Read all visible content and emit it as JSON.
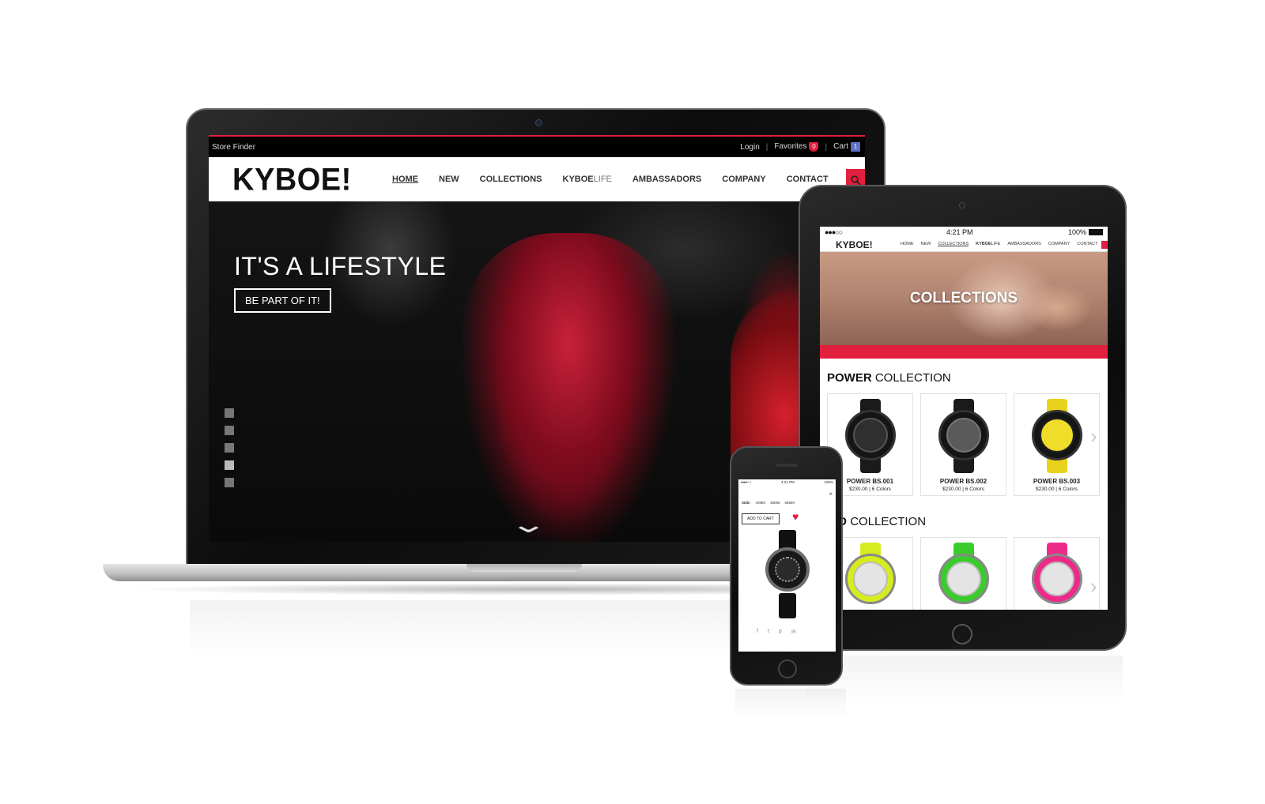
{
  "desktop": {
    "utility": {
      "store_finder": "Store Finder",
      "login": "Login",
      "favorites": "Favorites",
      "favorites_count": "0",
      "cart": "Cart",
      "cart_count": "1"
    },
    "logo": "KYBOE!",
    "nav": [
      "HOME",
      "NEW",
      "COLLECTIONS",
      "KYBOE",
      "LIFE",
      "AMBASSADORS",
      "COMPANY",
      "CONTACT"
    ],
    "hero": {
      "title": "IT'S A LIFESTYLE",
      "button": "BE PART OF IT!"
    }
  },
  "tablet": {
    "status": {
      "signal": "●●●○○",
      "time": "4:21 PM",
      "battery": "100%"
    },
    "logo": "KYBOE!",
    "nav": [
      "HOME",
      "NEW",
      "COLLECTIONS",
      "KYBOE",
      "LIFE",
      "AMBASSADORS",
      "COMPANY",
      "CONTACT"
    ],
    "banner_title": "COLLECTIONS",
    "power_section": {
      "bold": "POWER",
      "rest": "COLLECTION"
    },
    "power_products": [
      {
        "name": "POWER BS.001",
        "price": "$230.00 | 6 Colors",
        "color": "#1a1a1a",
        "dial": "#2f2f2f"
      },
      {
        "name": "POWER BS.002",
        "price": "$230.00 | 6 Colors",
        "color": "#1a1a1a",
        "dial": "#5a5a5a"
      },
      {
        "name": "POWER BS.003",
        "price": "$230.00 | 6 Colors",
        "color": "#e8d21b",
        "dial": "#f0dd2a"
      }
    ],
    "vivid_section": {
      "bold": "VID",
      "rest": "COLLECTION"
    },
    "vivid_products": [
      {
        "color": "#d6ec1f",
        "dial": "#e4e4e4"
      },
      {
        "color": "#39cc2c",
        "dial": "#e4e4e4"
      },
      {
        "color": "#ee2a88",
        "dial": "#e4e4e4"
      }
    ]
  },
  "phone": {
    "status": {
      "left": "●●●○○",
      "time": "4:21 PM",
      "battery": "100%"
    },
    "close": "×",
    "size_label": "SIZE:",
    "sizes": [
      "40MM",
      "48MM",
      "55MM"
    ],
    "add_to_cart": "ADD TO CART",
    "share_icons": [
      "f",
      "t",
      "p",
      "✉"
    ]
  },
  "colors": {
    "accent": "#e21f3d",
    "badge_blue": "#5b6fc7"
  }
}
